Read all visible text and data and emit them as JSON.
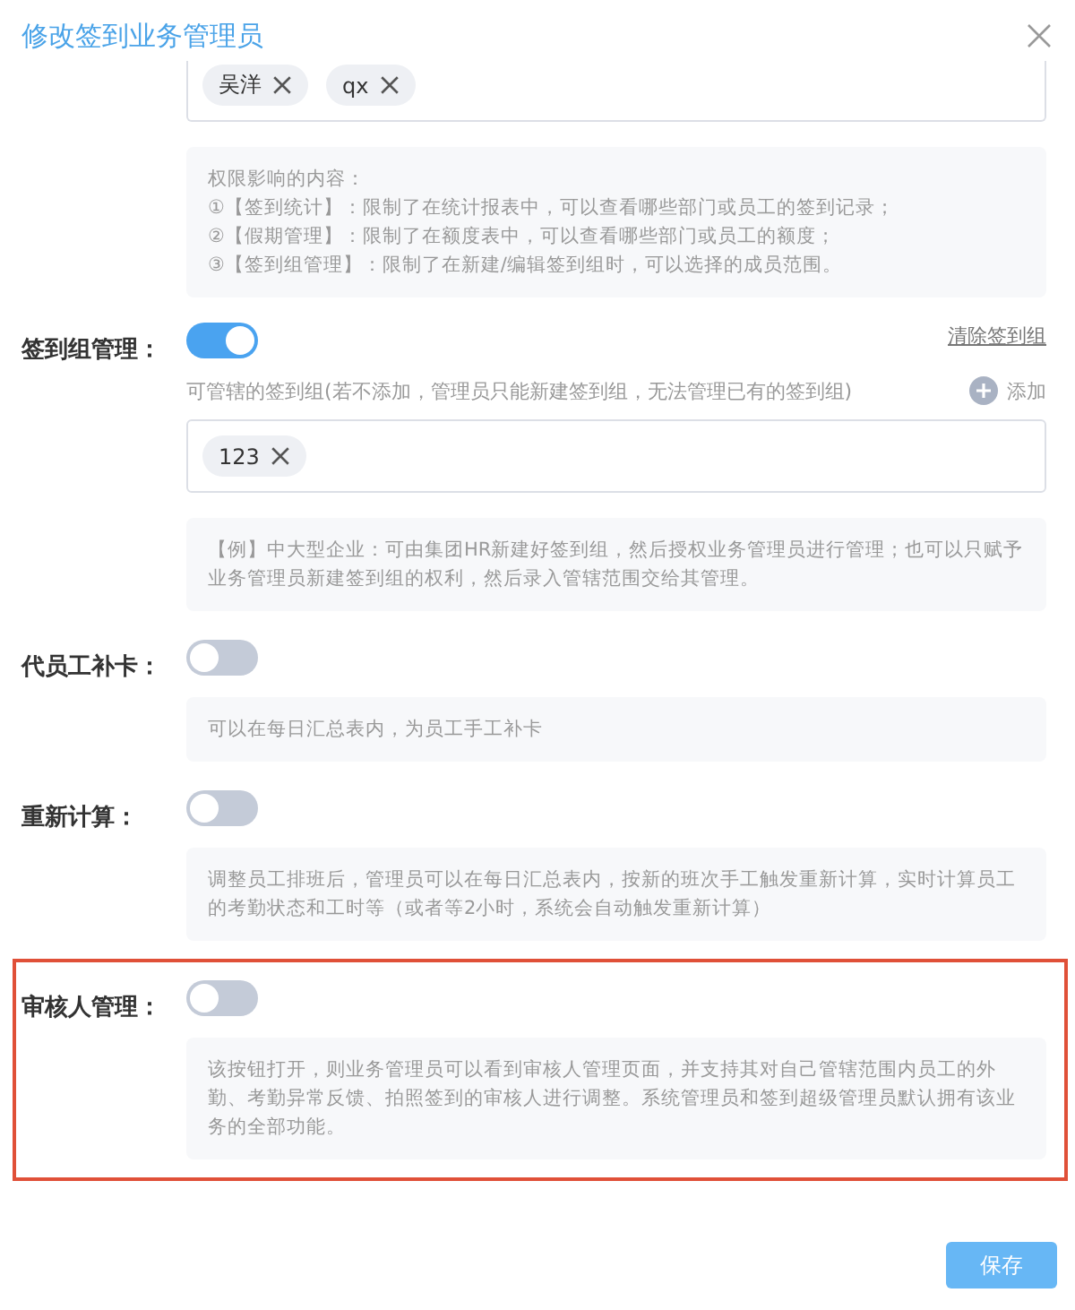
{
  "title": "修改签到业务管理员",
  "top_tags": [
    "吴洋",
    "qx"
  ],
  "info_lines": [
    "权限影响的内容：",
    "①【签到统计】：限制了在统计报表中，可以查看哪些部门或员工的签到记录；",
    "②【假期管理】：限制了在额度表中，可以查看哪些部门或员工的额度；",
    "③【签到组管理】：限制了在新建/编辑签到组时，可以选择的成员范围。"
  ],
  "sections": [
    {
      "label": "签到组管理：",
      "on": true,
      "highlighted": false,
      "link": "清除签到组",
      "hint": "可管辖的签到组(若不添加，管理员只能新建签到组，无法管理已有的签到组)",
      "add_label": "添加",
      "tags": [
        "123"
      ],
      "note": "【例】中大型企业：可由集团HR新建好签到组，然后授权业务管理员进行管理；也可以只赋予业务管理员新建签到组的权利，然后录入管辖范围交给其管理。"
    },
    {
      "label": "代员工补卡：",
      "on": false,
      "highlighted": false,
      "note": "可以在每日汇总表内，为员工手工补卡"
    },
    {
      "label": "重新计算：",
      "on": false,
      "highlighted": false,
      "note": "调整员工排班后，管理员可以在每日汇总表内，按新的班次手工触发重新计算，实时计算员工的考勤状态和工时等（或者等2小时，系统会自动触发重新计算）"
    },
    {
      "label": "审核人管理：",
      "on": false,
      "highlighted": true,
      "note": "该按钮打开，则业务管理员可以看到审核人管理页面，并支持其对自己管辖范围内员工的外勤、考勤异常反馈、拍照签到的审核人进行调整。系统管理员和签到超级管理员默认拥有该业务的全部功能。"
    }
  ],
  "save_label": "保存"
}
